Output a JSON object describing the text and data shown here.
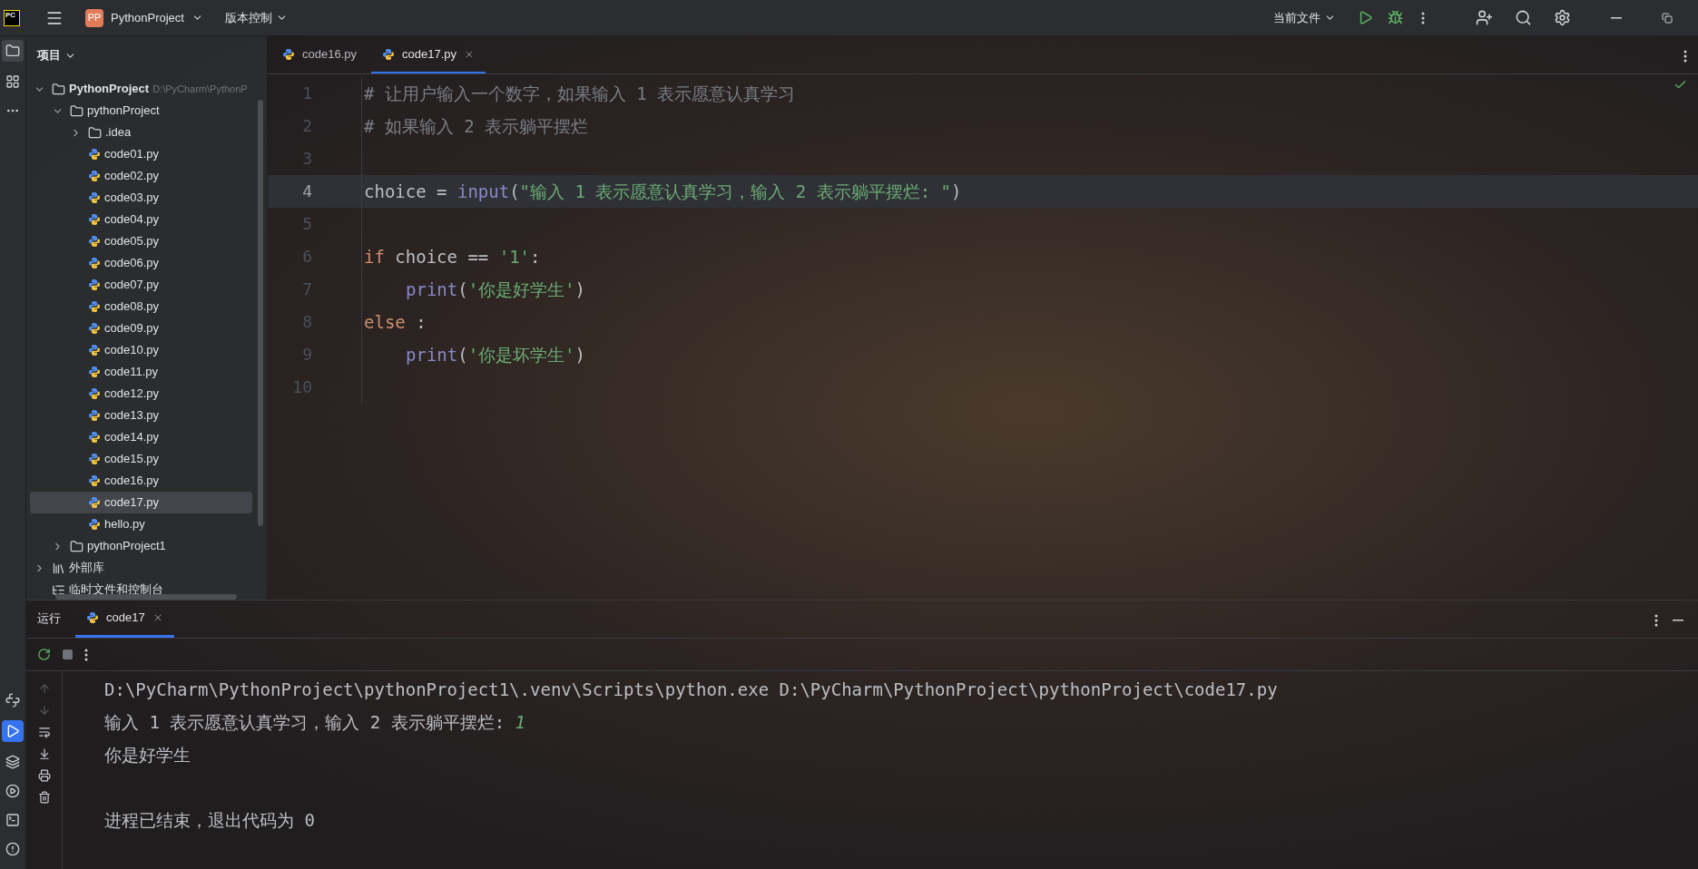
{
  "title_bar": {
    "logo": "PC",
    "project_badge": "PP",
    "project": "PythonProject",
    "vcs": "版本控制",
    "run_config": "当前文件"
  },
  "project_panel": {
    "title": "项目",
    "tree": [
      {
        "kind": "folder",
        "label": "PythonProject",
        "path": "D:\\PyCharm\\PythonP",
        "expanded": true,
        "selected": false,
        "children": [
          {
            "kind": "folder",
            "label": "pythonProject",
            "expanded": true,
            "selected": false,
            "children": [
              {
                "kind": "folder",
                "label": ".idea",
                "expanded": false,
                "selected": false
              },
              {
                "kind": "python",
                "label": "code01.py",
                "selected": false
              },
              {
                "kind": "python",
                "label": "code02.py",
                "selected": false
              },
              {
                "kind": "python",
                "label": "code03.py",
                "selected": false
              },
              {
                "kind": "python",
                "label": "code04.py",
                "selected": false
              },
              {
                "kind": "python",
                "label": "code05.py",
                "selected": false
              },
              {
                "kind": "python",
                "label": "code06.py",
                "selected": false
              },
              {
                "kind": "python",
                "label": "code07.py",
                "selected": false
              },
              {
                "kind": "python",
                "label": "code08.py",
                "selected": false
              },
              {
                "kind": "python",
                "label": "code09.py",
                "selected": false
              },
              {
                "kind": "python",
                "label": "code10.py",
                "selected": false
              },
              {
                "kind": "python",
                "label": "code11.py",
                "selected": false
              },
              {
                "kind": "python",
                "label": "code12.py",
                "selected": false
              },
              {
                "kind": "python",
                "label": "code13.py",
                "selected": false
              },
              {
                "kind": "python",
                "label": "code14.py",
                "selected": false
              },
              {
                "kind": "python",
                "label": "code15.py",
                "selected": false
              },
              {
                "kind": "python",
                "label": "code16.py",
                "selected": false
              },
              {
                "kind": "python",
                "label": "code17.py",
                "selected": true
              },
              {
                "kind": "python",
                "label": "hello.py",
                "selected": false
              }
            ]
          },
          {
            "kind": "folder",
            "label": "pythonProject1",
            "expanded": false,
            "selected": false
          }
        ]
      },
      {
        "kind": "library",
        "label": "外部库",
        "expanded": false,
        "selected": false
      },
      {
        "kind": "scratch",
        "label": "临时文件和控制台",
        "selected": false
      }
    ]
  },
  "editor": {
    "tabs": [
      {
        "label": "code16.py",
        "selected": false
      },
      {
        "label": "code17.py",
        "selected": true
      }
    ],
    "lines": [
      {
        "number": "1",
        "current": false,
        "tokens": [
          {
            "kind": "comment",
            "text": "# 让用户输入一个数字，如果输入 1 表示愿意认真学习"
          }
        ]
      },
      {
        "number": "2",
        "current": false,
        "tokens": [
          {
            "kind": "comment",
            "text": "# 如果输入 2 表示躺平摆烂"
          }
        ]
      },
      {
        "number": "3",
        "current": false
      },
      {
        "number": "4",
        "current": true,
        "tokens": [
          {
            "kind": "plain",
            "text": "choice = "
          },
          {
            "kind": "builtin",
            "text": "input"
          },
          {
            "kind": "plain",
            "text": "("
          },
          {
            "kind": "string",
            "text": "\"输入 1 表示愿意认真学习，输入 2 表示躺平摆烂: \""
          },
          {
            "kind": "plain",
            "text": ")"
          }
        ]
      },
      {
        "number": "5",
        "current": false
      },
      {
        "number": "6",
        "current": false,
        "tokens": [
          {
            "kind": "keyword",
            "text": "if"
          },
          {
            "kind": "plain",
            "text": " choice == "
          },
          {
            "kind": "string",
            "text": "'1'"
          },
          {
            "kind": "plain",
            "text": ":"
          }
        ],
        "children": [
          {
            "number": "7",
            "current": false,
            "tokens": [
              {
                "kind": "builtin",
                "text": "print"
              },
              {
                "kind": "plain",
                "text": "("
              },
              {
                "kind": "string",
                "text": "'你是好学生'"
              },
              {
                "kind": "plain",
                "text": ")"
              }
            ]
          }
        ]
      },
      {
        "number": "8",
        "current": false,
        "tokens": [
          {
            "kind": "keyword",
            "text": "else"
          },
          {
            "kind": "plain",
            "text": " :"
          }
        ],
        "children": [
          {
            "number": "9",
            "current": false,
            "tokens": [
              {
                "kind": "builtin",
                "text": "print"
              },
              {
                "kind": "plain",
                "text": "("
              },
              {
                "kind": "string",
                "text": "'你是坏学生'"
              },
              {
                "kind": "plain",
                "text": ")"
              }
            ]
          }
        ]
      },
      {
        "number": "10",
        "current": false
      }
    ]
  },
  "run_panel": {
    "title": "运行",
    "tabs": [
      {
        "label": "code17",
        "selected": true
      }
    ],
    "output": [
      {
        "kind": "output",
        "segments": [
          {
            "kind": "plain",
            "text": "D:\\PyCharm\\PythonProject\\pythonProject1\\.venv\\Scripts\\python.exe D:\\PyCharm\\PythonProject\\pythonProject\\code17.py"
          }
        ]
      },
      {
        "kind": "output",
        "segments": [
          {
            "kind": "plain",
            "text": "输入 1 表示愿意认真学习，输入 2 表示躺平摆烂: "
          },
          {
            "kind": "input",
            "text": "1"
          }
        ]
      },
      {
        "kind": "output",
        "segments": [
          {
            "kind": "plain",
            "text": "你是好学生"
          }
        ]
      },
      {
        "kind": "exit",
        "segments": [
          {
            "kind": "plain",
            "text": "进程已结束，退出代码为 0"
          }
        ]
      }
    ]
  }
}
